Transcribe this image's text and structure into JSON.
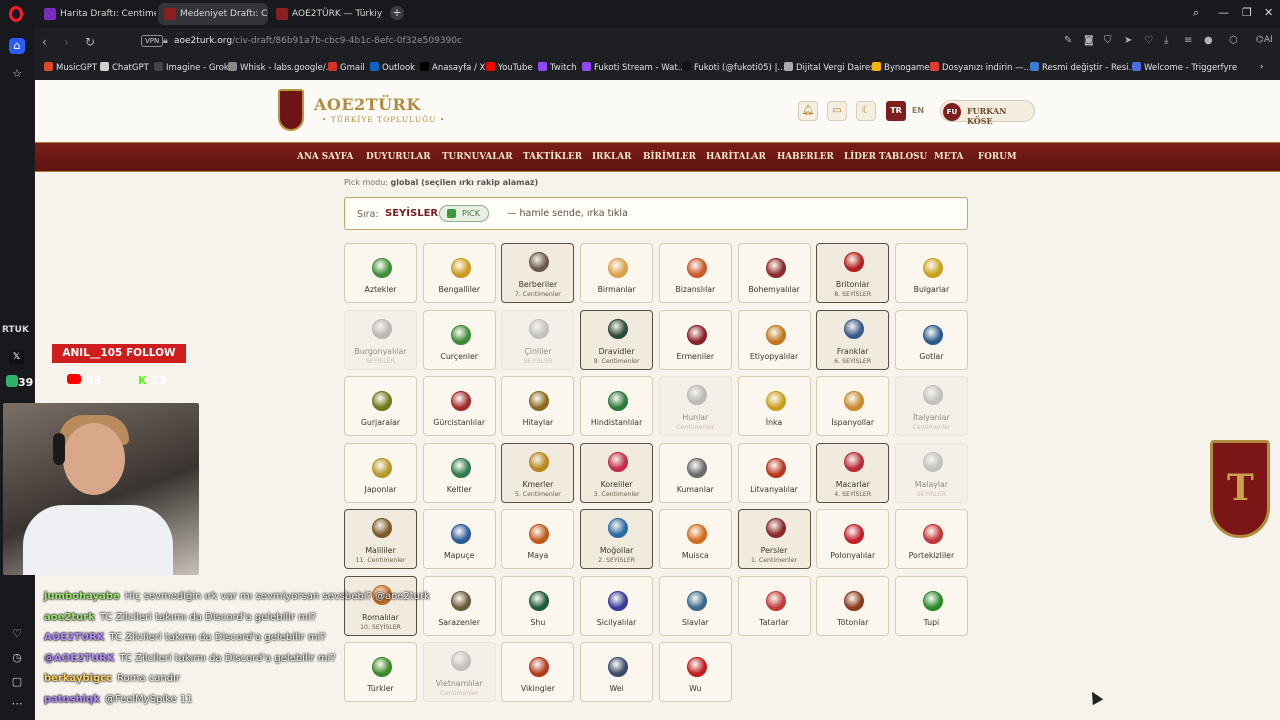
{
  "browser": {
    "tabs": [
      {
        "label": "Harita Draftı: Centimenler",
        "active": false
      },
      {
        "label": "Medeniyet Draftı: Centim",
        "active": true
      },
      {
        "label": "AOE2TÜRK — Türkiye Top",
        "active": false
      }
    ],
    "url_host": "aoe2turk.org",
    "url_path": "/civ-draft/86b91a7b-cbc9-4b1c-8efc-0f32e509390c",
    "vpn_label": "VPN",
    "bookmarks": [
      "MusicGPT",
      "ChatGPT",
      "Imagine - Grok",
      "Whisk - labs.google/...",
      "Gmail",
      "Outlook",
      "Anasayfa / X",
      "YouTube",
      "Twitch",
      "Fukoti Stream - Wat...",
      "Fukoti (@fukoti05) |...",
      "Dijital Vergi Dairesi",
      "Bynogame",
      "Dosyanızı indirin —...",
      "Resmi değiştir - Resi...",
      "Welcome - Triggerfyre"
    ],
    "accent": "#ff1b2d"
  },
  "site": {
    "logo_title": "AOE2TÜRK",
    "logo_subtitle": "• TÜRKİYE TOPLULUĞU •",
    "lang_tr": "TR",
    "lang_en": "EN",
    "user_initials": "FU",
    "user_name": "FURKAN KÖSE",
    "nav": [
      "ANA SAYFA",
      "DUYURULAR",
      "TURNUVALAR",
      "TAKTİKLER",
      "IRKLAR",
      "BİRİMLER",
      "HARİTALAR",
      "HABERLER",
      "LİDER TABLOSU",
      "META",
      "FORUM"
    ],
    "brand_color": "#7c1d18",
    "gold_color": "#b48a3c"
  },
  "draft": {
    "pick_mode_label": "Pick modu:",
    "pick_mode_value": "global (seçilen ırkı rakip alamaz)",
    "turn_label": "Sıra:",
    "turn_team": "SEYİSLER",
    "pick_badge": "PICK",
    "turn_message": "— hamle sende, ırka tıkla",
    "civs": [
      {
        "name": "Aztekler",
        "state": "normal",
        "sub": "",
        "color": "#3f8f3a"
      },
      {
        "name": "Bengalliler",
        "state": "normal",
        "sub": "",
        "color": "#c89a1e"
      },
      {
        "name": "Berberiler",
        "state": "taken",
        "sub": "7. Centimenler",
        "color": "#6b5a4a"
      },
      {
        "name": "Birmanlar",
        "state": "normal",
        "sub": "",
        "color": "#d9a04a"
      },
      {
        "name": "Bizanslılar",
        "state": "normal",
        "sub": "",
        "color": "#c9582a"
      },
      {
        "name": "Bohemyalılar",
        "state": "normal",
        "sub": "",
        "color": "#8a2a2a"
      },
      {
        "name": "Britonlar",
        "state": "taken",
        "sub": "8. SEYİSLER",
        "color": "#b51f1f"
      },
      {
        "name": "Bulgarlar",
        "state": "normal",
        "sub": "",
        "color": "#c9a01e"
      },
      {
        "name": "Burgonyalılar",
        "state": "banned",
        "sub": "SEYİSLER",
        "color": "#8a8a8a"
      },
      {
        "name": "Curçenler",
        "state": "normal",
        "sub": "",
        "color": "#3d8a3a"
      },
      {
        "name": "Çinliler",
        "state": "banned",
        "sub": "SEYİSLER",
        "color": "#9a9a9a"
      },
      {
        "name": "Dravidler",
        "state": "taken",
        "sub": "9. Centimenler",
        "color": "#2f4a3a"
      },
      {
        "name": "Ermeniler",
        "state": "normal",
        "sub": "",
        "color": "#8a1f2a"
      },
      {
        "name": "Etiyopyalılar",
        "state": "normal",
        "sub": "",
        "color": "#c2761e"
      },
      {
        "name": "Franklar",
        "state": "taken",
        "sub": "6. SEYİSLER",
        "color": "#3a5a8a"
      },
      {
        "name": "Gotlar",
        "state": "normal",
        "sub": "",
        "color": "#2a5a8a"
      },
      {
        "name": "Gurjaralar",
        "state": "normal",
        "sub": "",
        "color": "#6a7a1e"
      },
      {
        "name": "Gürcistanlılar",
        "state": "normal",
        "sub": "",
        "color": "#a32a2a"
      },
      {
        "name": "Hitaylar",
        "state": "normal",
        "sub": "",
        "color": "#8a6a1e"
      },
      {
        "name": "Hindistanlılar",
        "state": "normal",
        "sub": "",
        "color": "#2a7a3a"
      },
      {
        "name": "Hunlar",
        "state": "banned",
        "sub": "Centimenler",
        "color": "#8a8a8a"
      },
      {
        "name": "İnka",
        "state": "normal",
        "sub": "",
        "color": "#c9a01e"
      },
      {
        "name": "İspanyollar",
        "state": "normal",
        "sub": "",
        "color": "#c98a2a"
      },
      {
        "name": "İtalyanlar",
        "state": "banned",
        "sub": "Centimenler",
        "color": "#9a9a9a"
      },
      {
        "name": "Japonlar",
        "state": "normal",
        "sub": "",
        "color": "#b8962a"
      },
      {
        "name": "Keltler",
        "state": "normal",
        "sub": "",
        "color": "#2f7a4a"
      },
      {
        "name": "Kmerler",
        "state": "taken",
        "sub": "5. Centimenler",
        "color": "#b8861e"
      },
      {
        "name": "Koreliler",
        "state": "taken",
        "sub": "3. Centimenler",
        "color": "#c22a4a"
      },
      {
        "name": "Kumanlar",
        "state": "normal",
        "sub": "",
        "color": "#6a6a6a"
      },
      {
        "name": "Litvanyalılar",
        "state": "normal",
        "sub": "",
        "color": "#b8361e"
      },
      {
        "name": "Macarlar",
        "state": "taken",
        "sub": "4. SEYİSLER",
        "color": "#b82a3a"
      },
      {
        "name": "Malaylar",
        "state": "banned",
        "sub": "SEYİSLER",
        "color": "#9a9a9a"
      },
      {
        "name": "Malililer",
        "state": "taken",
        "sub": "11. Centimenler",
        "color": "#7a5a2a"
      },
      {
        "name": "Mapuçe",
        "state": "normal",
        "sub": "",
        "color": "#2a5a9a"
      },
      {
        "name": "Maya",
        "state": "normal",
        "sub": "",
        "color": "#c2561e"
      },
      {
        "name": "Moğollar",
        "state": "taken",
        "sub": "2. SEYİSLER",
        "color": "#2a6aa8"
      },
      {
        "name": "Muisca",
        "state": "normal",
        "sub": "",
        "color": "#d26a1e"
      },
      {
        "name": "Persler",
        "state": "taken",
        "sub": "1. Centimenler",
        "color": "#8a2a2a"
      },
      {
        "name": "Polonyalılar",
        "state": "normal",
        "sub": "",
        "color": "#c21e2a"
      },
      {
        "name": "Portekizliler",
        "state": "normal",
        "sub": "",
        "color": "#c2363a"
      },
      {
        "name": "Romalılar",
        "state": "taken",
        "sub": "10. SEYİSLER",
        "color": "#c26a1e"
      },
      {
        "name": "Sarazenler",
        "state": "normal",
        "sub": "",
        "color": "#6a5a3a"
      },
      {
        "name": "Shu",
        "state": "normal",
        "sub": "",
        "color": "#1e5a3a"
      },
      {
        "name": "Sicilyalılar",
        "state": "normal",
        "sub": "",
        "color": "#3a3a9a"
      },
      {
        "name": "Slavlar",
        "state": "normal",
        "sub": "",
        "color": "#3a6a8a"
      },
      {
        "name": "Tatarlar",
        "state": "normal",
        "sub": "",
        "color": "#c23a3a"
      },
      {
        "name": "Tötonlar",
        "state": "normal",
        "sub": "",
        "color": "#8a3a1e"
      },
      {
        "name": "Tupi",
        "state": "normal",
        "sub": "",
        "color": "#2a8a2a"
      },
      {
        "name": "Türkler",
        "state": "normal",
        "sub": "",
        "color": "#3a8a2a"
      },
      {
        "name": "Vietnamlılar",
        "state": "banned",
        "sub": "Centimenler",
        "color": "#9a9a9a"
      },
      {
        "name": "Vikingler",
        "state": "normal",
        "sub": "",
        "color": "#b23a1e"
      },
      {
        "name": "Wei",
        "state": "normal",
        "sub": "",
        "color": "#3a4a6a"
      },
      {
        "name": "Wu",
        "state": "normal",
        "sub": "",
        "color": "#c21e1e"
      }
    ]
  },
  "stream_overlay": {
    "follow_banner": "ANIL__105 FOLLOW",
    "ticker": "RTUK",
    "youtube_count": "89",
    "kick_count": "13",
    "ig_count": "39",
    "chat": [
      {
        "user": "jumbohayabe",
        "msg": "Hiç sevmediğin ırk var mı sevmiyorsan sevsbebi? @aoe2turk",
        "color": "#9fe870"
      },
      {
        "user": "aoe2turk",
        "msg": "TC Zilcileri takımı da Discord'a gelebilir mi?",
        "color": "#9fe870"
      },
      {
        "user": "AOE2TURK",
        "msg": "TC Zilcileri takımı da Discord'a gelebilir mi?",
        "color": "#b58cff"
      },
      {
        "user": "@AOE2TURK",
        "msg": "TC Zilcileri takımı da Discord'a gelebilir mi?",
        "color": "#b58cff"
      },
      {
        "user": "berkaybigcc",
        "msg": "Roma candır",
        "color": "#ffd35a"
      },
      {
        "user": "patoshiqk",
        "msg": "@FeelMySpike 11",
        "color": "#b58cff"
      }
    ]
  }
}
